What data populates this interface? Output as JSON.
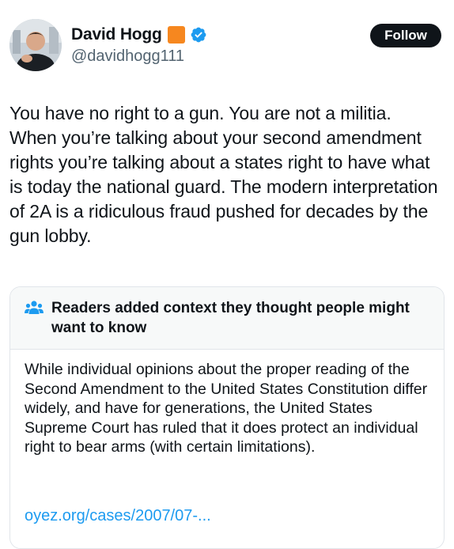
{
  "author": {
    "display_name": "David Hogg",
    "handle": "@davidhogg111",
    "badge_color": "#f6871f",
    "verified_color": "#1d9bf0"
  },
  "follow_button": {
    "label": "Follow"
  },
  "tweet": {
    "text": "You have no right to a gun. You are not a militia. When you’re talking about your second amendment rights you’re talking about a states right to have what is today the national guard. The modern interpretation of 2A is a ridiculous fraud pushed for decades by the gun lobby."
  },
  "community_note": {
    "icon": "people-icon",
    "title": "Readers added context they thought people might want to know",
    "body": "While individual opinions about the proper reading of the Second Amendment to the United States Constitution differ widely, and have for generations, the United States Supreme Court has ruled that it does protect an individual right to bear arms (with certain limitations).",
    "link": "oyez.org/cases/2007/07-..."
  }
}
